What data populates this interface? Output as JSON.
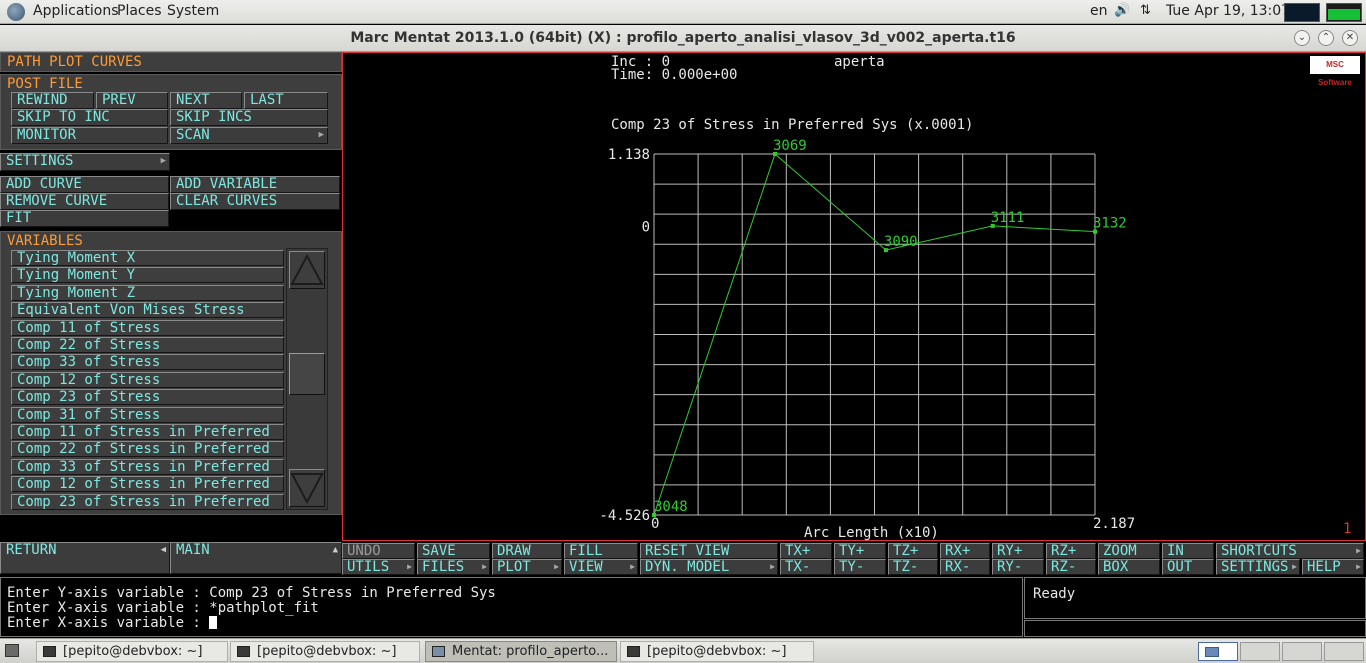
{
  "system_bar": {
    "menus": [
      "Applications",
      "Places",
      "System"
    ],
    "keyboard": "en",
    "datetime": "Tue Apr 19, 13:07"
  },
  "window": {
    "title": "Marc Mentat 2013.1.0 (64bit) (X) : profilo_aperto_analisi_vlasov_3d_v002_aperta.t16"
  },
  "left_panel": {
    "section_title": "PATH PLOT CURVES",
    "post_file": {
      "label": "POST FILE",
      "rewind": "REWIND",
      "prev": "PREV",
      "next": "NEXT",
      "last": "LAST",
      "skip_to_inc": "SKIP TO INC",
      "skip_incs": "SKIP INCS",
      "monitor": "MONITOR",
      "scan": "SCAN"
    },
    "settings": "SETTINGS",
    "add_curve": "ADD CURVE",
    "add_variable": "ADD VARIABLE",
    "remove_curve": "REMOVE CURVE",
    "clear_curves": "CLEAR CURVES",
    "fit": "FIT",
    "variables_label": "VARIABLES",
    "variables": [
      "Tying Moment X",
      "Tying Moment Y",
      "Tying Moment Z",
      "Equivalent Von Mises Stress",
      "Comp 11 of Stress",
      "Comp 22 of Stress",
      "Comp 33 of Stress",
      "Comp 12 of Stress",
      "Comp 23 of Stress",
      "Comp 31 of Stress",
      "Comp 11 of Stress in Preferred",
      "Comp 22 of Stress in Preferred",
      "Comp 33 of Stress in Preferred",
      "Comp 12 of Stress in Preferred",
      "Comp 23 of Stress in Preferred"
    ],
    "return": "RETURN",
    "main": "MAIN"
  },
  "graphics": {
    "inc_label": "Inc  : 0",
    "job_name": "aperta",
    "time_label": "Time:  0.000e+00",
    "logo_text": "MSC Software",
    "viewport_number": "1"
  },
  "chart_data": {
    "type": "line",
    "title": "Comp 23 of Stress in Preferred Sys (x.0001)",
    "xlabel": "Arc Length (x10)",
    "ylabel": "",
    "xlim": [
      0,
      2.187
    ],
    "ylim": [
      -4.526,
      1.138
    ],
    "x_tick_labels": [
      "0",
      "2.187"
    ],
    "y_tick_labels": [
      "1.138",
      "0",
      "-4.526"
    ],
    "grid": true,
    "grid_cols": 10,
    "grid_rows": 12,
    "line_color": "#2ecc2e",
    "series": [
      {
        "x": [
          0,
          0.6,
          1.15,
          1.68,
          2.187
        ],
        "y": [
          -4.526,
          1.138,
          -0.37,
          0.01,
          -0.08
        ],
        "point_labels": [
          "3048",
          "3069",
          "3090",
          "3111",
          "3132"
        ]
      }
    ]
  },
  "toolbar": {
    "row1": [
      "UNDO",
      "SAVE",
      "DRAW",
      "FILL",
      "RESET VIEW",
      "TX+",
      "TY+",
      "TZ+",
      "RX+",
      "RY+",
      "RZ+",
      "ZOOM",
      "IN",
      "SHORTCUTS"
    ],
    "row2": [
      "UTILS",
      "FILES",
      "PLOT",
      "VIEW",
      "DYN. MODEL",
      "TX-",
      "TY-",
      "TZ-",
      "RX-",
      "RY-",
      "RZ-",
      "BOX",
      "OUT",
      "SETTINGS",
      "HELP"
    ]
  },
  "command": {
    "lines": [
      "Enter Y-axis variable : Comp 23 of Stress in Preferred Sys",
      "Enter X-axis variable : *pathplot_fit",
      "Enter X-axis variable : "
    ]
  },
  "status": {
    "text": "Ready"
  },
  "taskbar": {
    "tasks": [
      "[pepito@debvbox: ~]",
      "[pepito@debvbox: ~]",
      "Mentat: profilo_aperto...",
      "[pepito@debvbox: ~]"
    ]
  }
}
